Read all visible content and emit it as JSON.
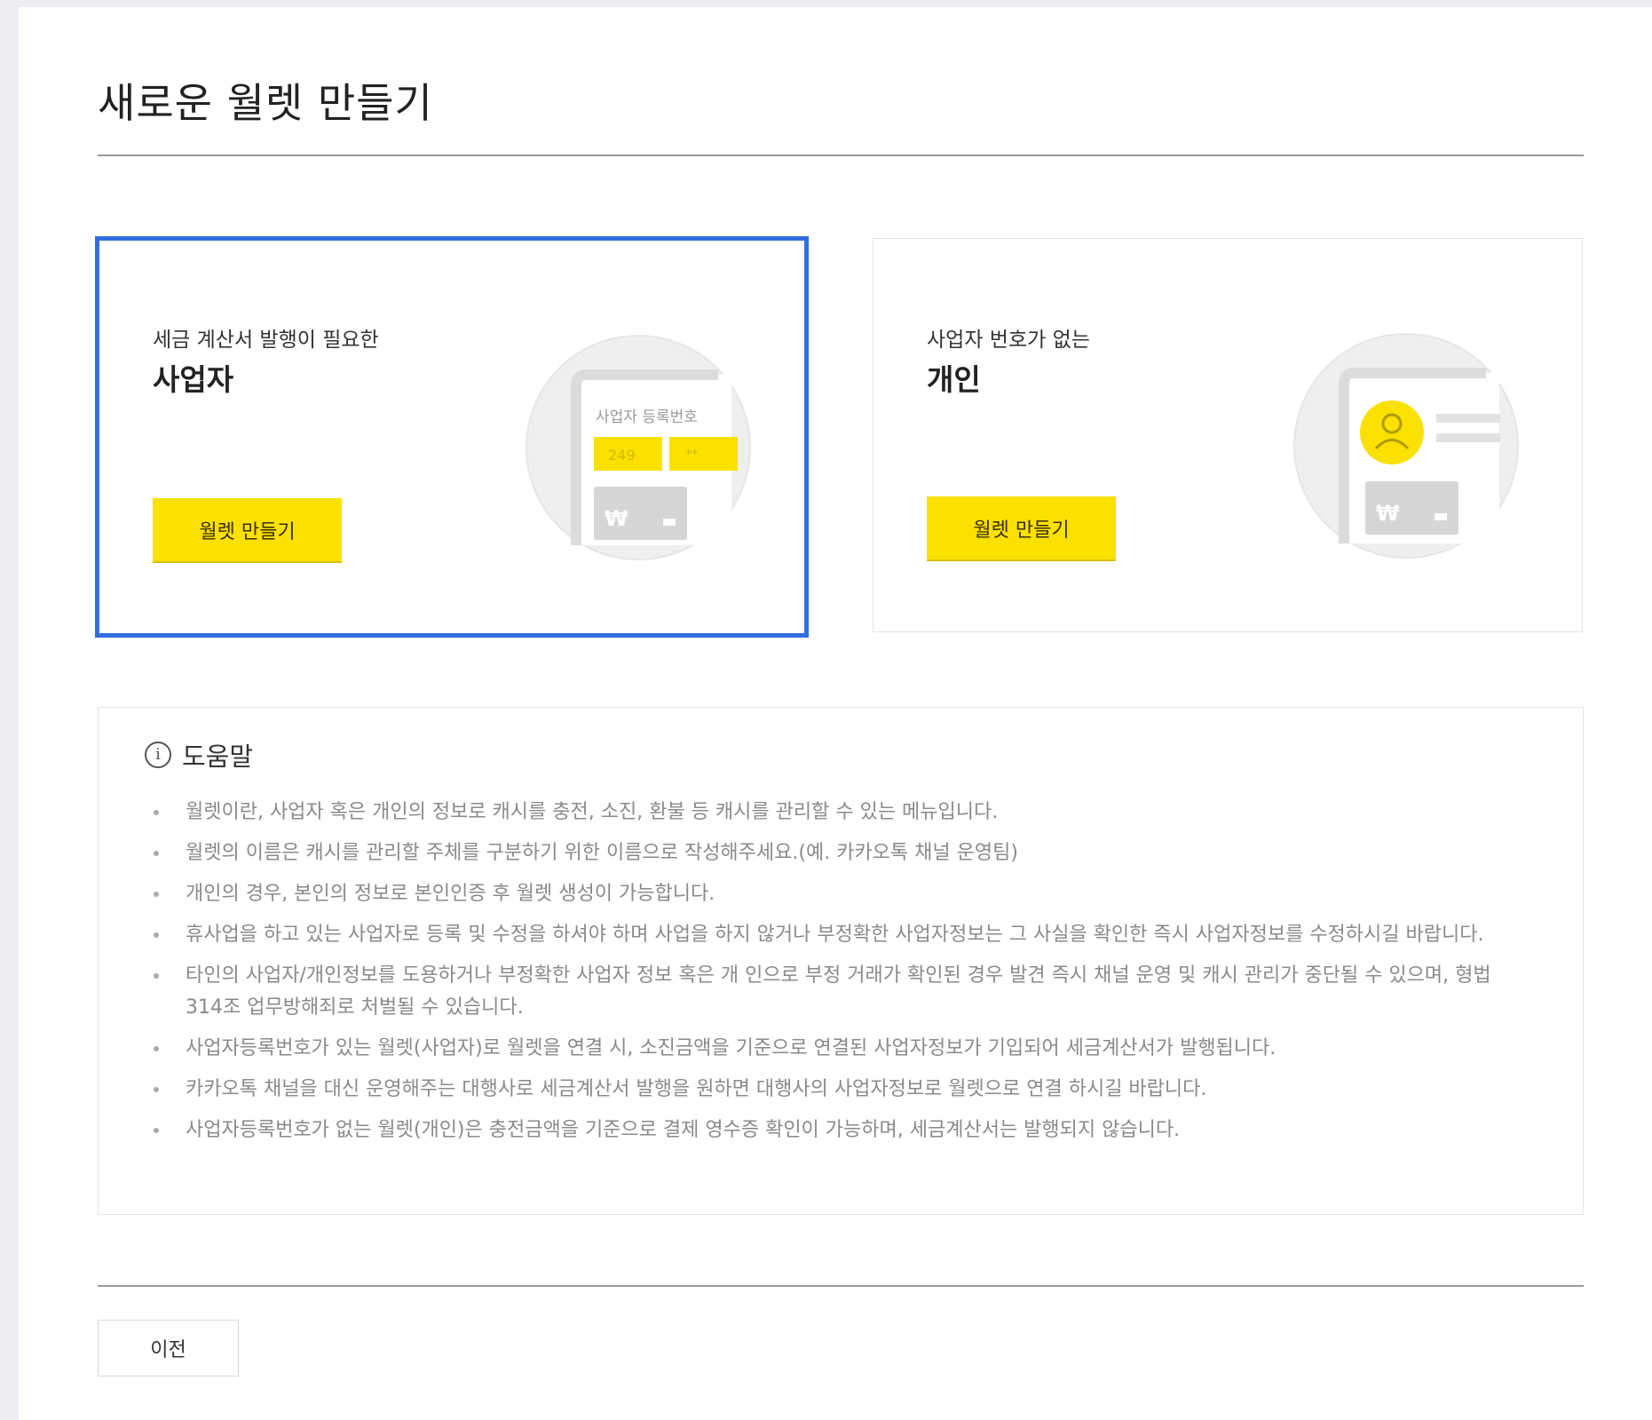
{
  "page": {
    "title": "새로운 월렛 만들기"
  },
  "cards": [
    {
      "subtitle": "세금 계산서 발행이 필요한",
      "title": "사업자",
      "button_label": "월렛 만들기",
      "illustration": {
        "label": "사업자 등록번호",
        "field1": "249",
        "field2": "**",
        "currency_symbol": "₩",
        "icon": "business-registration-icon"
      },
      "selected": true
    },
    {
      "subtitle": "사업자 번호가 없는",
      "title": "개인",
      "button_label": "월렛 만들기",
      "illustration": {
        "currency_symbol": "₩",
        "icon": "person-icon"
      },
      "selected": false
    }
  ],
  "help": {
    "title": "도움말",
    "items": [
      "월렛이란, 사업자 혹은 개인의 정보로 캐시를 충전, 소진, 환불 등 캐시를 관리할 수 있는 메뉴입니다.",
      "월렛의 이름은 캐시를 관리할 주체를 구분하기 위한 이름으로 작성해주세요.(예. 카카오톡 채널 운영팀)",
      "개인의 경우, 본인의 정보로 본인인증 후 월렛 생성이 가능합니다.",
      "휴사업을 하고 있는 사업자로 등록 및 수정을 하셔야 하며 사업을 하지 않거나 부정확한 사업자정보는 그 사실을 확인한 즉시 사업자정보를 수정하시길 바랍니다.",
      "타인의 사업자/개인정보를 도용하거나 부정확한 사업자 정보 혹은 개 인으로 부정 거래가 확인된 경우 발견 즉시 채널 운영 및 캐시 관리가 중단될 수 있으며, 형법 314조 업무방해죄로 처벌될 수 있습니다.",
      "사업자등록번호가 있는 월렛(사업자)로 월렛을 연결 시, 소진금액을 기준으로 연결된 사업자정보가 기입되어 세금계산서가 발행됩니다.",
      "카카오톡 채널을 대신 운영해주는 대행사로 세금계산서 발행을 원하면 대행사의 사업자정보로 월렛으로 연결 하시길 바랍니다.",
      "사업자등록번호가 없는 월렛(개인)은 충전금액을 기준으로 결제 영수증 확인이 가능하며, 세금계산서는 발행되지 않습니다."
    ]
  },
  "footer": {
    "prev_label": "이전"
  },
  "colors": {
    "accent_yellow": "#fae100",
    "selection_blue": "#2f6fe0"
  }
}
